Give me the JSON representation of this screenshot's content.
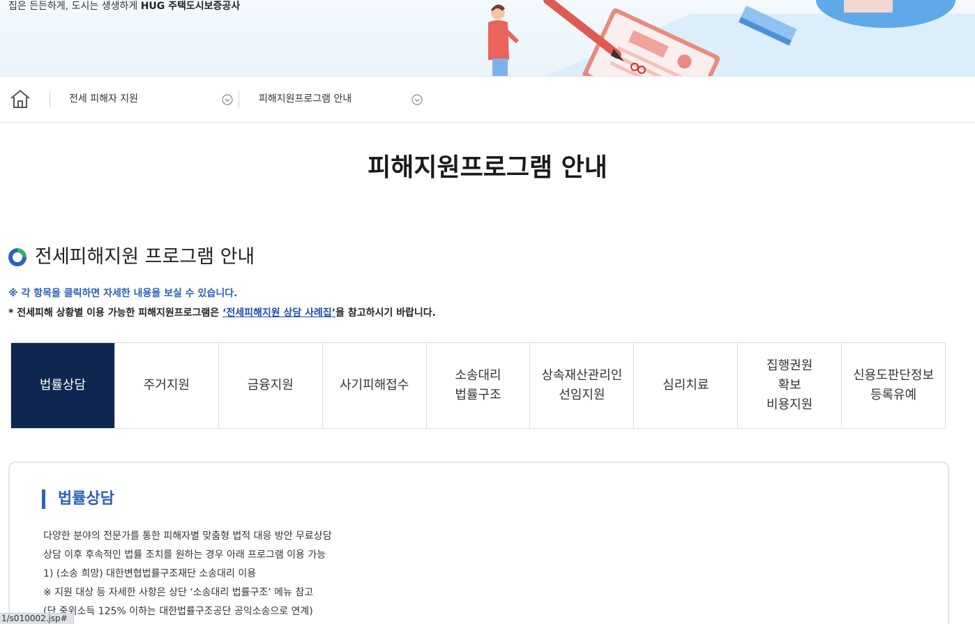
{
  "banner": {
    "slogan_plain": "집은 든든하게, 도시는 생생하게 ",
    "slogan_brand": "HUG 주택도시보증공사"
  },
  "locbar": {
    "crumb1": "전세 피해자 지원",
    "crumb2": "피해지원프로그램 안내"
  },
  "page_title": "피해지원프로그램 안내",
  "section": {
    "heading": "전세피해지원 프로그램 안내",
    "note1": "※ 각 항목을 클릭하면 자세한 내용을 보실 수 있습니다.",
    "note2_pre": "* 전세피해 상황별 이용 가능한 피해지원프로그램은 ",
    "note2_link": "‘전세피해지원 상담 사례집’",
    "note2_post": "을 참고하시기 바랍니다."
  },
  "tabs": [
    {
      "label": "법률상담",
      "active": true
    },
    {
      "label": "주거지원",
      "active": false
    },
    {
      "label": "금융지원",
      "active": false
    },
    {
      "label": "사기피해접수",
      "active": false
    },
    {
      "label": "소송대리\n법률구조",
      "active": false
    },
    {
      "label": "상속재산관리인\n선임지원",
      "active": false
    },
    {
      "label": "심리치료",
      "active": false
    },
    {
      "label": "집행권원\n확보\n비용지원",
      "active": false
    },
    {
      "label": "신용도판단정보\n등록유예",
      "active": false
    }
  ],
  "content": {
    "title": "법률상담",
    "lines": [
      "다양한 분야의 전문가를 통한 피해자별 맞춤형 법적 대응 방안 무료상담",
      "상담 이후 후속적인 법률 조치를 원하는 경우 아래 프로그램 이용 가능",
      "1) (소송 희망) 대한변협법률구조재단 소송대리 이용",
      "※ 지원 대상 등 자세한 사항은 상단 ‘소송대리 법률구조’ 메뉴 참고",
      "(단 중위소득 125% 이하는 대한법률구조공단 공익소송으로 연계)"
    ]
  },
  "status_url": "1/s010002.jsp#",
  "colors": {
    "active_tab": "#0f2650",
    "accent_blue": "#2a62b8",
    "banner_bg": "#eaf4fb"
  }
}
